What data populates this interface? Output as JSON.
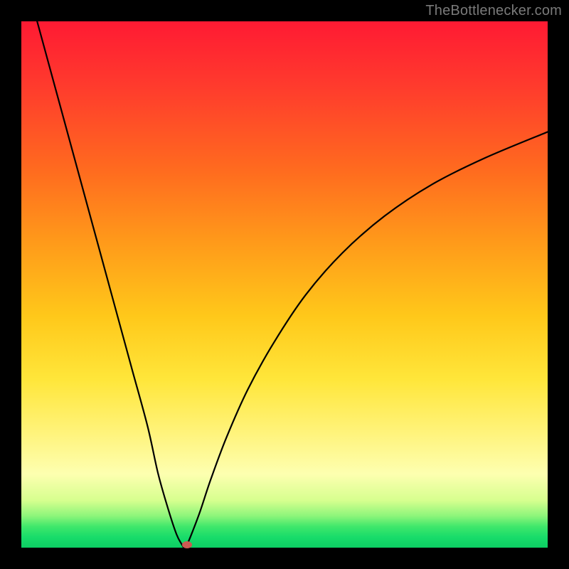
{
  "attribution": "TheBottlenecker.com",
  "chart_data": {
    "type": "line",
    "title": "",
    "xlabel": "",
    "ylabel": "",
    "xlim": [
      0,
      100
    ],
    "ylim": [
      0,
      100
    ],
    "legend": false,
    "grid": false,
    "background_gradient": {
      "top": "#ff1a33",
      "bottom": "#0cce63",
      "meaning": "bottleneck severity (red = high, green = none)"
    },
    "x": [
      3,
      6,
      9,
      12,
      15,
      18,
      21,
      24,
      26,
      28,
      29.5,
      30.5,
      31,
      31.5,
      32.5,
      34,
      36,
      39,
      43,
      48,
      54,
      61,
      69,
      78,
      88,
      100
    ],
    "values": [
      100,
      89,
      78,
      67,
      56,
      45,
      34,
      23,
      14,
      7,
      2.5,
      0.6,
      0,
      0.6,
      3,
      7,
      13,
      21,
      30,
      39,
      48,
      56,
      63,
      69,
      74,
      79
    ],
    "min_point": {
      "x": 31,
      "y": 0
    },
    "marker": {
      "x": 31.5,
      "y": 0.5,
      "color": "#cc5a52"
    }
  }
}
